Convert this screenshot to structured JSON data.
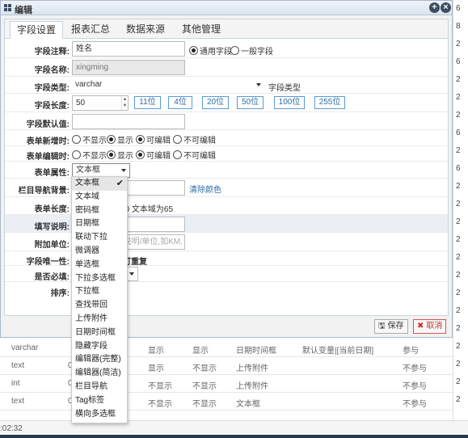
{
  "dialog": {
    "title": "编辑",
    "tabs": [
      "字段设置",
      "报表汇总",
      "数据来源",
      "其他管理"
    ],
    "active_tab": 0
  },
  "form": {
    "field_comment": {
      "label": "字段注释:",
      "value": "姓名",
      "opt_general": "通用字段",
      "opt_normal": "一般字段"
    },
    "field_name": {
      "label": "字段名称:",
      "value": "xingming"
    },
    "field_type": {
      "label": "字段类型:",
      "value": "varchar",
      "hint": "字段类型"
    },
    "field_length": {
      "label": "字段长度:",
      "value": "50",
      "presets": [
        "11位",
        "4位",
        "20位",
        "50位",
        "100位",
        "255位"
      ]
    },
    "default_value": {
      "label": "字段默认值:",
      "value": ""
    },
    "form_add": {
      "label": "表单新增时:",
      "opts": [
        "不显示",
        "显示",
        "可编辑",
        "不可编辑"
      ]
    },
    "form_edit": {
      "label": "表单编辑时:",
      "opts": [
        "不显示",
        "显示",
        "可编辑",
        "不可编辑"
      ]
    },
    "form_attr": {
      "label": "表单属性:",
      "value": "文本框"
    },
    "nav_bg": {
      "label": "栏目导航背景:",
      "clear": "清除颜色"
    },
    "form_length": {
      "label": "表单长度:",
      "hint": "20 文本域为65"
    },
    "fill_desc": {
      "label": "填写说明:"
    },
    "attach_unit": {
      "label": "附加单位:",
      "placeholder": "说明/单位,如KM,"
    },
    "unique": {
      "label": "字段唯一性:",
      "hint": "可重复"
    },
    "required": {
      "label": "是否必填:"
    },
    "sort": {
      "label": "排序:"
    }
  },
  "dropdown_options": [
    "文本框",
    "文本域",
    "密码框",
    "日期框",
    "联动下拉",
    "微调器",
    "单选框",
    "下拉多选框",
    "下拉框",
    "查找带回",
    "上传附件",
    "日期时间框",
    "隐藏字段",
    "编辑器(完整)",
    "编辑器(简洁)",
    "栏目导航",
    "Tag标签",
    "横向多选框"
  ],
  "buttons": {
    "save": "保存",
    "cancel": "取消"
  },
  "background_table": {
    "rows": [
      [
        "varchar",
        "显示",
        "显示",
        "日期时间框",
        "默认变量|[当前日期]",
        "参与"
      ],
      [
        "text",
        "显示",
        "不显示",
        "上传附件",
        "",
        "不参与"
      ],
      [
        "int",
        "不显示",
        "不显示",
        "上传附件",
        "",
        "不参与"
      ],
      [
        "text",
        "不显示",
        "不显示",
        "文本框",
        "",
        "不参与"
      ]
    ],
    "col2": [
      "",
      "0",
      "0",
      "0"
    ]
  },
  "right_edge_text": [
    "6",
    "8",
    "2",
    "6",
    "2",
    "2",
    "2",
    "6",
    "2",
    "6",
    "2",
    "2",
    "2",
    "2",
    "2",
    "2",
    "2",
    "2",
    "2",
    "2",
    "2",
    "2",
    "2"
  ],
  "footer_time": ":02:32"
}
